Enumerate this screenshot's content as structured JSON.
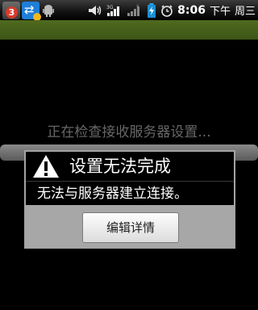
{
  "status_bar": {
    "notifications": [
      {
        "icon": "email-icon",
        "badge": "3"
      },
      {
        "icon": "sync-icon"
      },
      {
        "icon": "android-debug-icon"
      }
    ],
    "icons": [
      "volume-icon",
      "signal-3g-icon",
      "signal-weak-icon",
      "battery-charging-icon",
      "alarm-icon"
    ],
    "network_label": "3G",
    "time": "8:06",
    "ampm": "下午",
    "weekday": "周三"
  },
  "progress": {
    "text": "正在检查接收服务器设置..."
  },
  "dialog": {
    "icon": "alert-icon",
    "title": "设置无法完成",
    "message": "无法与服务器建立连接。",
    "button_label": "编辑详情"
  },
  "colors": {
    "title_bar": "#4a6420",
    "dialog_footer": "#a7a7a7",
    "progress_text": "#676767"
  }
}
